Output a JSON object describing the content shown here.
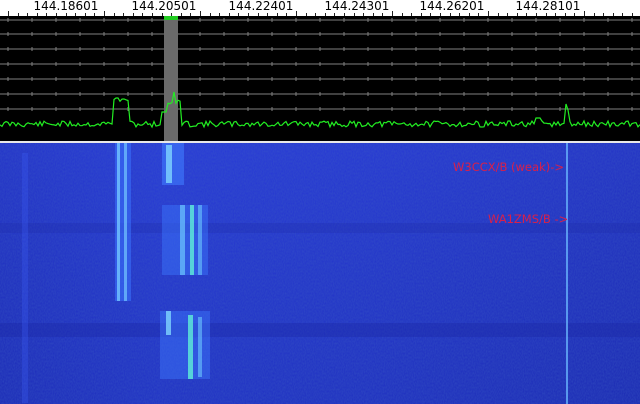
{
  "frequency_scale": {
    "labels": [
      "144.18601",
      "144.20501",
      "144.22401",
      "144.24301",
      "144.26201",
      "144.28101"
    ]
  },
  "waterfall": {
    "annotations": {
      "w3ccx": "W3CCX/B (weak)->",
      "wa1zms": "WA1ZMS/B ->"
    }
  },
  "colors": {
    "scale_background": "#ffffff",
    "spectrum_background": "#000000",
    "spectrum_trace": "#22ee22",
    "grid_lines": "#808080",
    "selection_band": "#6a6a6a",
    "selection_marker": "#22cc22",
    "waterfall_background": "#1f2fc8",
    "signal_highlight": "#40e0ff",
    "annotation_text": "#d8204a"
  }
}
